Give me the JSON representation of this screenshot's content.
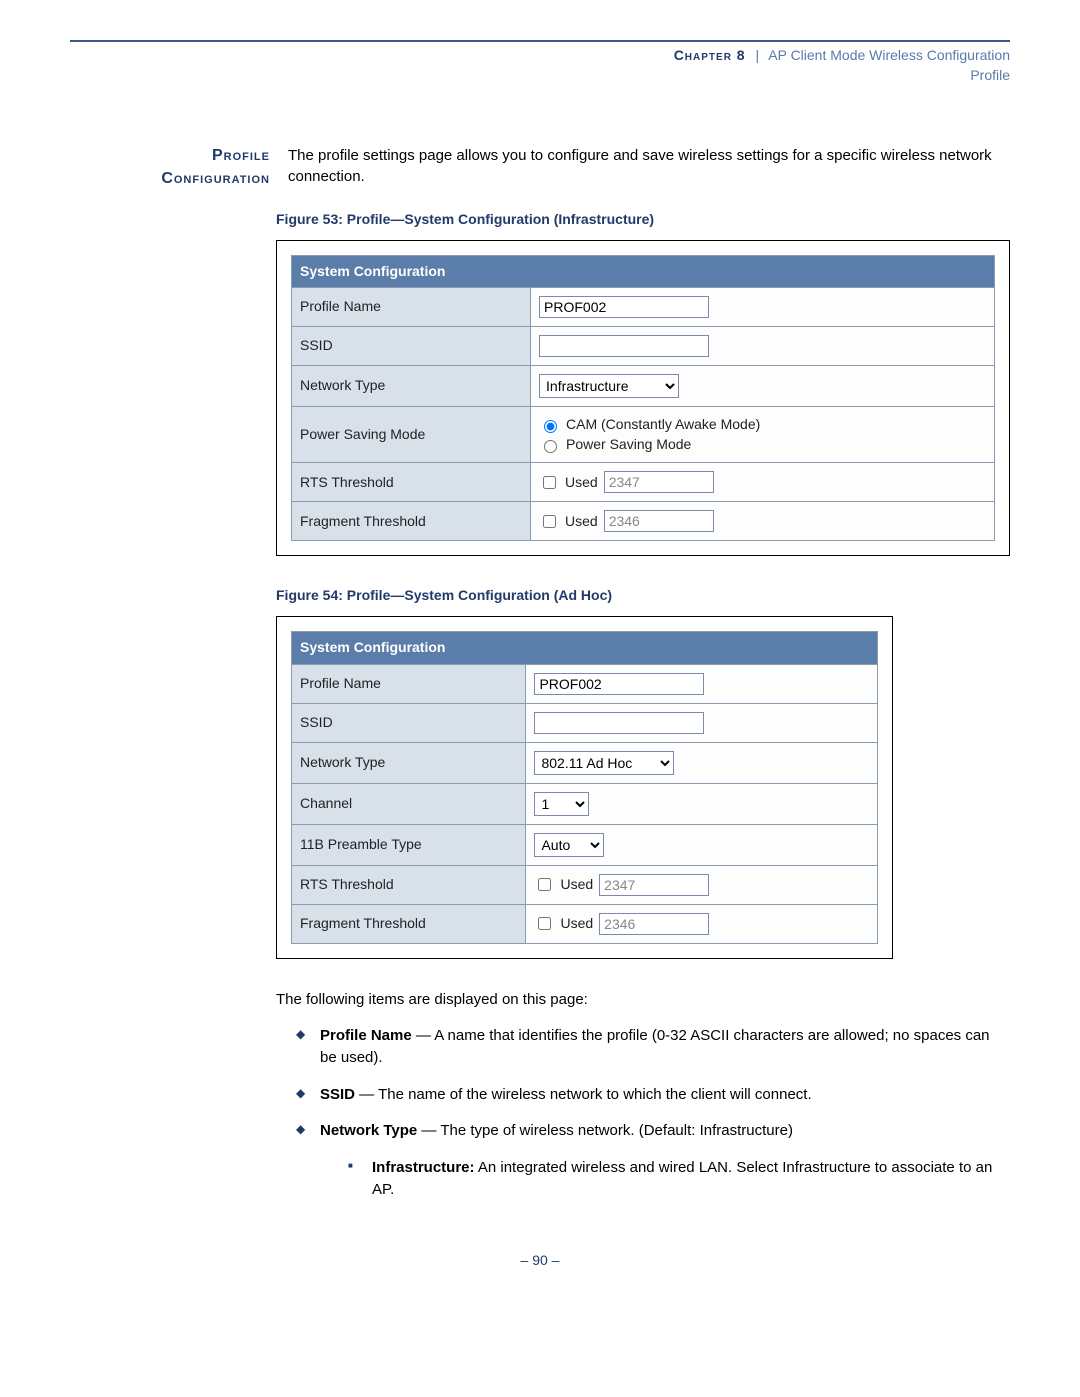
{
  "header": {
    "chapter_label": "Chapter 8",
    "chapter_title": "AP Client Mode Wireless Configuration",
    "subtitle": "Profile"
  },
  "section_label_line1": "Profile",
  "section_label_line2": "Configuration",
  "intro_text": "The profile settings page allows you to configure and save wireless settings for a specific wireless network connection.",
  "figure53": {
    "caption": "Figure 53:  Profile—System Configuration (Infrastructure)",
    "table_header": "System Configuration",
    "rows": {
      "profile_name_label": "Profile Name",
      "profile_name_value": "PROF002",
      "ssid_label": "SSID",
      "ssid_value": "",
      "network_type_label": "Network Type",
      "network_type_value": "Infrastructure",
      "psm_label": "Power Saving Mode",
      "psm_opt1": "CAM (Constantly Awake Mode)",
      "psm_opt2": "Power Saving Mode",
      "rts_label": "RTS Threshold",
      "rts_used": "Used",
      "rts_value": "2347",
      "frag_label": "Fragment Threshold",
      "frag_used": "Used",
      "frag_value": "2346"
    }
  },
  "figure54": {
    "caption": "Figure 54:  Profile—System Configuration (Ad Hoc)",
    "table_header": "System Configuration",
    "rows": {
      "profile_name_label": "Profile Name",
      "profile_name_value": "PROF002",
      "ssid_label": "SSID",
      "ssid_value": "",
      "network_type_label": "Network Type",
      "network_type_value": "802.11 Ad Hoc",
      "channel_label": "Channel",
      "channel_value": "1",
      "preamble_label": "11B Preamble Type",
      "preamble_value": "Auto",
      "rts_label": "RTS Threshold",
      "rts_used": "Used",
      "rts_value": "2347",
      "frag_label": "Fragment Threshold",
      "frag_used": "Used",
      "frag_value": "2346"
    }
  },
  "intro2": "The following items are displayed on this page:",
  "bullets": {
    "b1_term": "Profile Name",
    "b1_desc": " — A name that identifies the profile (0-32 ASCII characters are allowed; no spaces can be used).",
    "b2_term": "SSID",
    "b2_desc": " — The name of the wireless network to which the client will connect.",
    "b3_term": "Network Type",
    "b3_desc": " — The type of wireless network. (Default: Infrastructure)",
    "b3s1_term": "Infrastructure:",
    "b3s1_desc": " An integrated wireless and wired LAN. Select Infrastructure to associate to an AP."
  },
  "page_number": "–  90  –"
}
